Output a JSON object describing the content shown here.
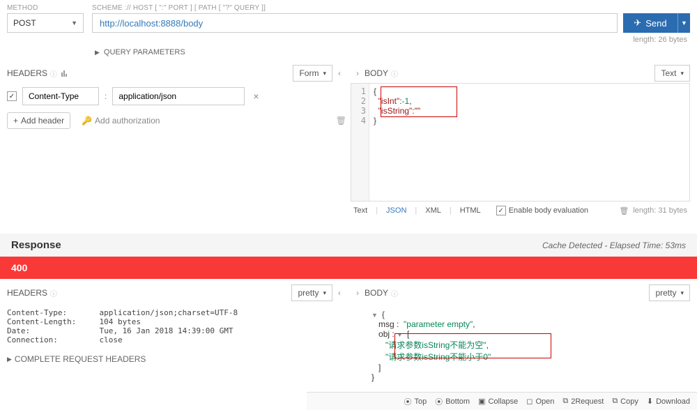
{
  "labels": {
    "method": "METHOD",
    "scheme": "SCHEME :// HOST [ \":\" PORT ] [ PATH [ \"?\" QUERY ]]",
    "query_parameters": "QUERY PARAMETERS",
    "headers": "HEADERS",
    "body": "BODY"
  },
  "request": {
    "method": "POST",
    "url": "http://localhost:8888/body",
    "length_text": "length: 26 bytes",
    "send_label": "Send"
  },
  "headers_pane": {
    "mode": "Form",
    "items": [
      {
        "enabled": true,
        "name": "Content-Type",
        "value": "application/json"
      }
    ],
    "add_header": "Add header",
    "add_auth": "Add authorization"
  },
  "body_pane": {
    "mode": "Text",
    "lines": [
      "{",
      "  \"isInt\":-1,",
      "  \"isString\":\"\"",
      "}"
    ],
    "format_tabs": [
      "Text",
      "JSON",
      "XML",
      "HTML"
    ],
    "active_format": "JSON",
    "enable_eval": "Enable body evaluation",
    "length_text": "length: 31 bytes"
  },
  "response": {
    "title": "Response",
    "cache_text": "Cache Detected - Elapsed Time: 53ms",
    "status_code": "400",
    "headers_mode": "pretty",
    "body_mode": "pretty",
    "headers_list": [
      {
        "k": "Content-Type:",
        "v": "application/json;charset=UTF-8"
      },
      {
        "k": "Content-Length:",
        "v": "104 bytes"
      },
      {
        "k": "Date:",
        "v": "Tue, 16 Jan 2018 14:39:00 GMT"
      },
      {
        "k": "Connection:",
        "v": "close"
      }
    ],
    "complete_label": "COMPLETE REQUEST HEADERS",
    "json": {
      "msg": "parameter empty",
      "obj": [
        "请求参数isString不能为空",
        "请求参数isString不能小于0"
      ]
    }
  },
  "bottom_bar": {
    "top": "Top",
    "bottom": "Bottom",
    "collapse": "Collapse",
    "open": "Open",
    "to_request": "2Request",
    "copy": "Copy",
    "download": "Download"
  }
}
